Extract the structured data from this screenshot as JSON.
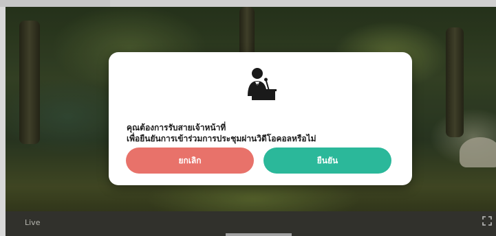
{
  "player": {
    "live_label": "Live",
    "icons": {
      "fullscreen": "fullscreen-icon"
    }
  },
  "dialog": {
    "icon": "speaker-at-podium-icon",
    "message_line1": "คุณต้องการรับสายเจ้าหน้าที่",
    "message_line2": "เพื่อยืนยันการเข้าร่วมการประชุมผ่านวิดีโอคอลหรือไม่",
    "cancel_label": "ยกเลิก",
    "confirm_label": "ยืนยัน"
  },
  "colors": {
    "cancel": "#e8726a",
    "confirm": "#2bb89a",
    "dialog_bg": "#ffffff"
  }
}
